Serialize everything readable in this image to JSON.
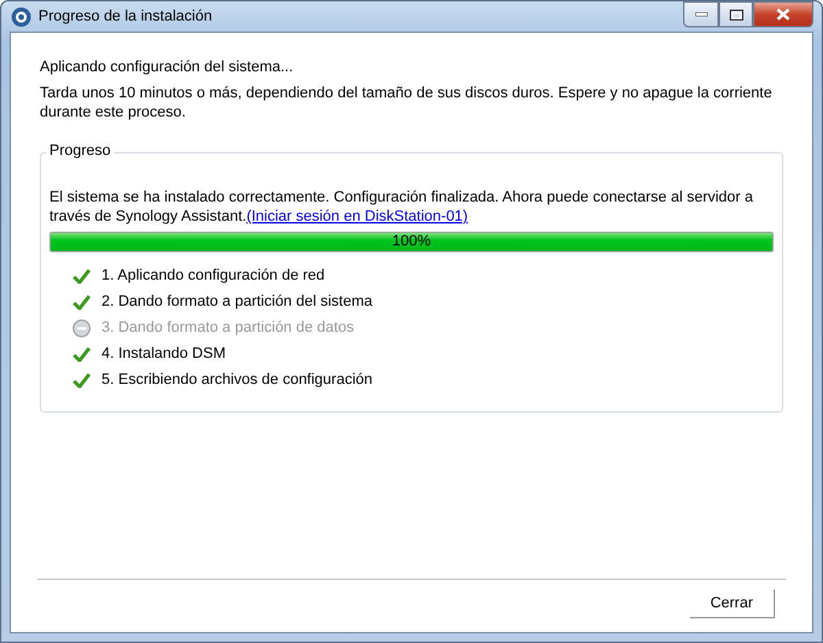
{
  "window": {
    "title": "Progreso de la instalación"
  },
  "heading": "Aplicando configuración del sistema...",
  "description": "Tarda unos 10 minutos o más, dependiendo del tamaño de sus discos duros. Espere y no apague la corriente durante este proceso.",
  "progress": {
    "legend": "Progreso",
    "message": "El sistema se ha instalado correctamente. Configuración finalizada. Ahora puede conectarse al servidor a través de Synology Assistant.",
    "link": "(Iniciar sesión en DiskStation-01)",
    "level": 1,
    "reading": "100%",
    "steps": [
      {
        "label": "1. Aplicando configuración de red",
        "kind": "done"
      },
      {
        "label": "2. Dando formato a partición del sistema",
        "kind": "done"
      },
      {
        "label": "3. Dando formato a partición de datos",
        "kind": "skipped"
      },
      {
        "label": "4. Instalando DSM",
        "kind": "done"
      },
      {
        "label": "5. Escribiendo archivos de configuración",
        "kind": "done"
      }
    ]
  },
  "buttons": [
    {
      "label": "Cerrar"
    }
  ]
}
